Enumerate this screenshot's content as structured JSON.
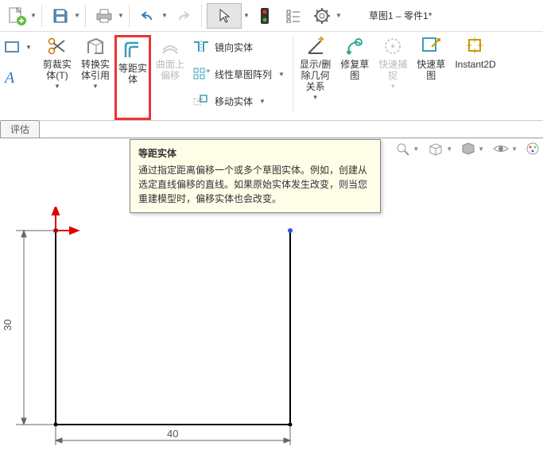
{
  "title": "草图1 – 零件1*",
  "ribbon": {
    "trim": "剪裁实\n体(T)",
    "convert": "转换实\n体引用",
    "offset": "等距实\n体",
    "surface_offset": "曲面上\n偏移",
    "mirror": "镜向实体",
    "linear_pattern": "线性草图阵列",
    "move": "移动实体",
    "show_relations": "显示/删\n除几何\n关系",
    "repair": "修复草\n图",
    "quick_snap": "快速捕\n捉",
    "quick_sketch": "快速草\n图",
    "instant2d": "Instant2D"
  },
  "tab": "评估",
  "tooltip": {
    "title": "等距实体",
    "body": "通过指定距离偏移一个或多个草图实体。例如，创建从选定直线偏移的直线。如果原始实体发生改变，则当您重建模型时，偏移实体也会改变。"
  },
  "sketch": {
    "height_dim": "30",
    "width_dim": "40"
  }
}
